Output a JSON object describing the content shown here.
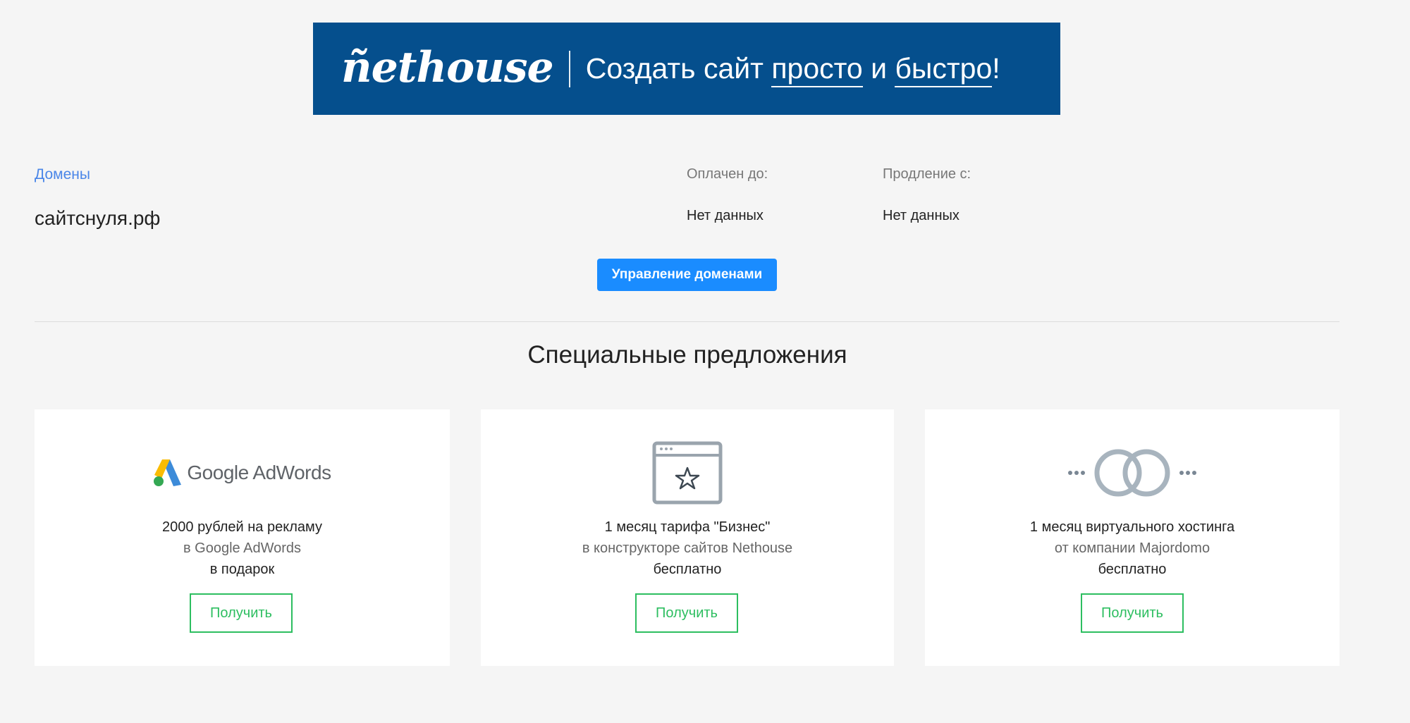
{
  "banner": {
    "logo": "ñethouse",
    "slogan_part1": "Создать сайт ",
    "slogan_part2": "просто",
    "slogan_part3": " и ",
    "slogan_part4": "быстро",
    "slogan_part5": "!",
    "background": "#054f8d"
  },
  "domains": {
    "link_label": "Домены",
    "domain_name": "сайтснуля.рф",
    "paid_until_label": "Оплачен до:",
    "paid_until_value": "Нет данных",
    "renewal_label": "Продление с:",
    "renewal_value": "Нет данных",
    "manage_button": "Управление доменами"
  },
  "offers": {
    "title": "Специальные предложения",
    "cards": [
      {
        "icon": "google-adwords-logo",
        "logo_text": "Google AdWords",
        "line1": "2000 рублей на рекламу",
        "line2": "в Google AdWords",
        "line3": "в подарок",
        "button": "Получить"
      },
      {
        "icon": "browser-star-icon",
        "line1": "1 месяц тарифа \"Бизнес\"",
        "line2": "в конструкторе сайтов Nethouse",
        "line3": "бесплатно",
        "button": "Получить"
      },
      {
        "icon": "majordomo-logo",
        "line1": "1 месяц виртуального хостинга",
        "line2": "от компании Majordomo",
        "line3": "бесплатно",
        "button": "Получить"
      }
    ]
  },
  "colors": {
    "accent_blue": "#1a8cff",
    "link_blue": "#4a86e8",
    "green": "#2dbe60",
    "page_bg": "#f5f5f5"
  }
}
